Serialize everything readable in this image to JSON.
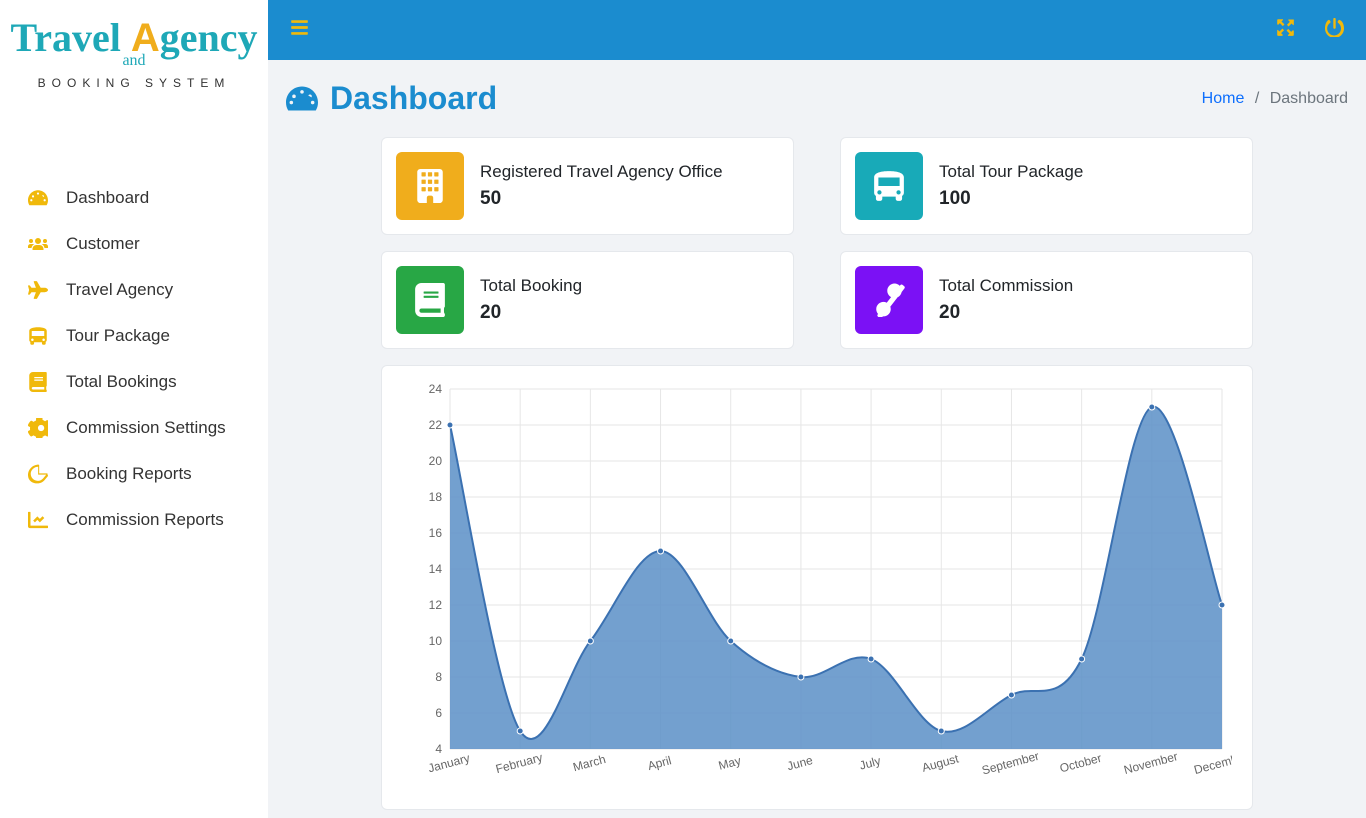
{
  "logo": {
    "line1": "Travel Agency",
    "and": "and",
    "sub": "BOOKING SYSTEM"
  },
  "nav": [
    {
      "label": "Dashboard"
    },
    {
      "label": "Customer"
    },
    {
      "label": "Travel Agency"
    },
    {
      "label": "Tour Package"
    },
    {
      "label": "Total Bookings"
    },
    {
      "label": "Commission Settings"
    },
    {
      "label": "Booking Reports"
    },
    {
      "label": "Commission Reports"
    }
  ],
  "page": {
    "title": "Dashboard"
  },
  "breadcrumb": {
    "home": "Home",
    "current": "Dashboard",
    "sep": "/"
  },
  "stats": {
    "agency": {
      "label": "Registered Travel Agency Office",
      "value": "50"
    },
    "package": {
      "label": "Total Tour Package",
      "value": "100"
    },
    "booking": {
      "label": "Total Booking",
      "value": "20"
    },
    "commission": {
      "label": "Total Commission",
      "value": "20"
    }
  },
  "chart_data": {
    "type": "area",
    "categories": [
      "January",
      "February",
      "March",
      "April",
      "May",
      "June",
      "July",
      "August",
      "September",
      "October",
      "November",
      "December"
    ],
    "values": [
      22,
      5,
      10,
      15,
      10,
      8,
      9,
      5,
      7,
      9,
      23,
      12
    ],
    "ylim": [
      4,
      24
    ],
    "ystep": 2
  }
}
